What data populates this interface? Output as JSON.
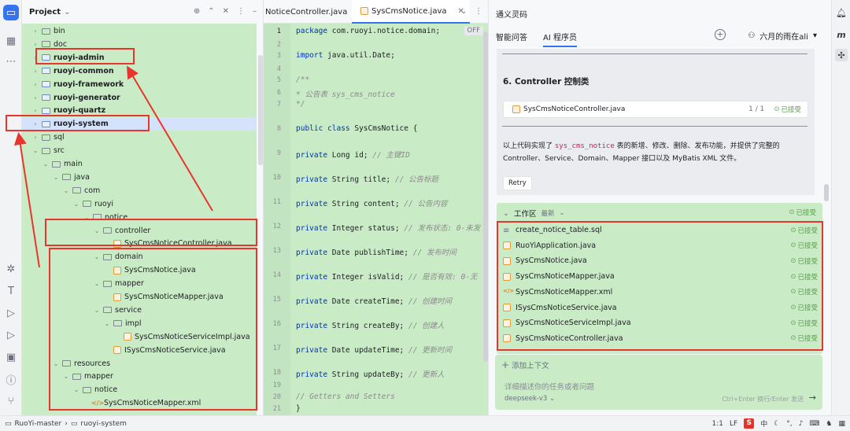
{
  "project": {
    "title": "Project",
    "chevron": "⌄",
    "tree": [
      {
        "label": "bin",
        "type": "folder",
        "depth": 1,
        "chev": "›"
      },
      {
        "label": "doc",
        "type": "folder",
        "depth": 1,
        "chev": "›"
      },
      {
        "label": "ruoyi-admin",
        "type": "module",
        "depth": 1,
        "chev": "›",
        "bold": true
      },
      {
        "label": "ruoyi-common",
        "type": "module",
        "depth": 1,
        "chev": "›",
        "bold": true
      },
      {
        "label": "ruoyi-framework",
        "type": "module",
        "depth": 1,
        "chev": "›",
        "bold": true
      },
      {
        "label": "ruoyi-generator",
        "type": "module",
        "depth": 1,
        "chev": "›",
        "bold": true
      },
      {
        "label": "ruoyi-quartz",
        "type": "module",
        "depth": 1,
        "chev": "›",
        "bold": true
      },
      {
        "label": "ruoyi-system",
        "type": "module",
        "depth": 1,
        "chev": "›",
        "bold": true,
        "selected": true
      },
      {
        "label": "sql",
        "type": "folder",
        "depth": 1,
        "chev": "›"
      },
      {
        "label": "src",
        "type": "folder",
        "depth": 1,
        "chev": "⌄"
      },
      {
        "label": "main",
        "type": "folder",
        "depth": 2,
        "chev": "⌄"
      },
      {
        "label": "java",
        "type": "folder",
        "depth": 3,
        "chev": "⌄"
      },
      {
        "label": "com",
        "type": "folder",
        "depth": 4,
        "chev": "⌄"
      },
      {
        "label": "ruoyi",
        "type": "folder",
        "depth": 5,
        "chev": "⌄"
      },
      {
        "label": "notice",
        "type": "folder",
        "depth": 6,
        "chev": "⌄"
      },
      {
        "label": "controller",
        "type": "folder",
        "depth": 7,
        "chev": "⌄"
      },
      {
        "label": "SysCmsNoticeController.java",
        "type": "java",
        "depth": 8,
        "chev": ""
      },
      {
        "label": "domain",
        "type": "folder",
        "depth": 7,
        "chev": "⌄"
      },
      {
        "label": "SysCmsNotice.java",
        "type": "java",
        "depth": 8,
        "chev": ""
      },
      {
        "label": "mapper",
        "type": "folder",
        "depth": 7,
        "chev": "⌄"
      },
      {
        "label": "SysCmsNoticeMapper.java",
        "type": "java",
        "depth": 8,
        "chev": ""
      },
      {
        "label": "service",
        "type": "folder",
        "depth": 7,
        "chev": "⌄"
      },
      {
        "label": "impl",
        "type": "folder",
        "depth": 8,
        "chev": "⌄"
      },
      {
        "label": "SysCmsNoticeServiceImpl.java",
        "type": "java",
        "depth": 9,
        "chev": ""
      },
      {
        "label": "ISysCmsNoticeService.java",
        "type": "java",
        "depth": 8,
        "chev": ""
      },
      {
        "label": "resources",
        "type": "folder",
        "depth": 3,
        "chev": "⌄"
      },
      {
        "label": "mapper",
        "type": "folder",
        "depth": 4,
        "chev": "⌄"
      },
      {
        "label": "notice",
        "type": "folder",
        "depth": 5,
        "chev": "⌄"
      },
      {
        "label": "SysCmsNoticeMapper.xml",
        "type": "xml",
        "depth": 6,
        "chev": ""
      }
    ]
  },
  "editor": {
    "tabs": [
      {
        "label": "NoticeController.java",
        "active": false
      },
      {
        "label": "SysCmsNotice.java",
        "active": true
      }
    ],
    "off_badge": "OFF",
    "lines": [
      {
        "n": "1",
        "html": "<span class='kw'>package</span> com.ruoyi.notice.domain;",
        "cur": true
      },
      {
        "n": "2",
        "html": ""
      },
      {
        "n": "3",
        "html": "<span class='kw'>import</span> java.util.Date;"
      },
      {
        "n": "4",
        "html": ""
      },
      {
        "n": "5",
        "html": "<span class='cmt'>/**</span>"
      },
      {
        "n": "6",
        "html": "<span class='cmt'> * 公告表 sys_cms_notice</span>"
      },
      {
        "n": "7",
        "html": "<span class='cmt'> */</span>"
      },
      {
        "n": "8",
        "html": "<span class='kw'>public class</span> SysCmsNotice {"
      },
      {
        "n": "9",
        "html": "    <span class='kw'>private</span> Long id; <span class='cmt'>// 主键ID</span>"
      },
      {
        "n": "10",
        "html": "    <span class='kw'>private</span> String title; <span class='cmt'>// 公告标题</span>"
      },
      {
        "n": "11",
        "html": "    <span class='kw'>private</span> String content; <span class='cmt'>// 公告内容</span>"
      },
      {
        "n": "12",
        "html": "    <span class='kw'>private</span> Integer status; <span class='cmt'>// 发布状态: 0-未发</span>"
      },
      {
        "n": "13",
        "html": "    <span class='kw'>private</span> Date publishTime; <span class='cmt'>// 发布时间</span>"
      },
      {
        "n": "14",
        "html": "    <span class='kw'>private</span> Integer isValid; <span class='cmt'>// 是否有效: 0-无</span>"
      },
      {
        "n": "15",
        "html": "    <span class='kw'>private</span> Date createTime; <span class='cmt'>// 创建时间</span>"
      },
      {
        "n": "16",
        "html": "    <span class='kw'>private</span> String createBy; <span class='cmt'>// 创建人</span>"
      },
      {
        "n": "17",
        "html": "    <span class='kw'>private</span> Date updateTime; <span class='cmt'>// 更新时间</span>"
      },
      {
        "n": "18",
        "html": "    <span class='kw'>private</span> String updateBy; <span class='cmt'>// 更新人</span>"
      },
      {
        "n": "19",
        "html": ""
      },
      {
        "n": "20",
        "html": "    <span class='cmt'>// Getters and Setters</span>"
      },
      {
        "n": "21",
        "html": "}"
      }
    ]
  },
  "ai": {
    "title": "通义灵码",
    "tabs": [
      {
        "label": "智能问答",
        "active": false
      },
      {
        "label": "AI 程序员",
        "active": true
      }
    ],
    "user": "六月的雨在ali",
    "heading": "6. Controller 控制类",
    "file_card": {
      "name": "SysCmsNoticeController.java",
      "count": "1 / 1",
      "status": "已接受"
    },
    "text_before": "以上代码实现了 ",
    "text_code": "sys_cms_notice",
    "text_after": " 表的新增、修改、删除、发布功能，并提供了完整的 Controller、Service、Domain、Mapper 接口以及 MyBatis XML 文件。",
    "retry": "Retry",
    "work": {
      "title": "工作区",
      "sort": "最新",
      "status": "已接受",
      "files": [
        {
          "name": "create_notice_table.sql",
          "icon": "sql",
          "status": "已接受"
        },
        {
          "name": "RuoYiApplication.java",
          "icon": "java",
          "status": "已接受"
        },
        {
          "name": "SysCmsNotice.java",
          "icon": "java",
          "status": "已接受"
        },
        {
          "name": "SysCmsNoticeMapper.java",
          "icon": "java",
          "status": "已接受"
        },
        {
          "name": "SysCmsNoticeMapper.xml",
          "icon": "xml",
          "status": "已接受"
        },
        {
          "name": "ISysCmsNoticeService.java",
          "icon": "java",
          "status": "已接受"
        },
        {
          "name": "SysCmsNoticeServiceImpl.java",
          "icon": "java",
          "status": "已接受"
        },
        {
          "name": "SysCmsNoticeController.java",
          "icon": "java",
          "status": "已接受"
        }
      ]
    },
    "input": {
      "add_context": "添加上下文",
      "placeholder": "详细描述你的任务或者问题",
      "model": "deepseek-v3 ⌄",
      "hint": "Ctrl+Enter 换行/Enter 发送"
    }
  },
  "status": {
    "crumb1": "RuoYi-master",
    "crumb2": "ruoyi-system",
    "pos": "1:1",
    "lf": "LF",
    "ime": "S",
    "ime_lang": "中"
  },
  "colors": {
    "accent": "#3574f0",
    "annotation": "#e8352e",
    "highlight_bg": "#c9ebc6"
  }
}
